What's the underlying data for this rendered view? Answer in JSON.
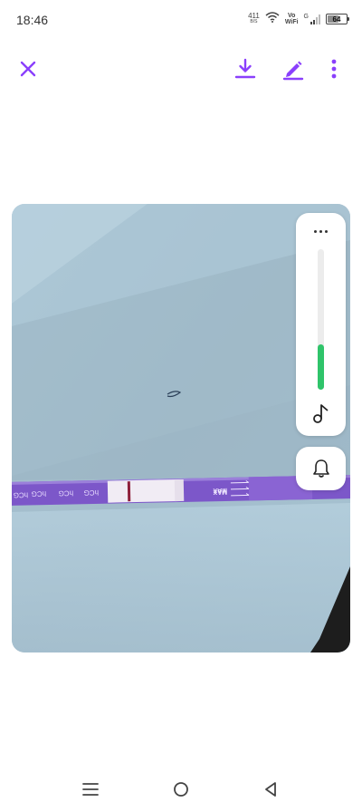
{
  "status_bar": {
    "time": "18:46",
    "net_speed_value": "411",
    "net_speed_unit": "B/S",
    "volte_top": "Vo",
    "volte_bottom": "WiFi",
    "network_type": "G",
    "battery_level": "64",
    "battery_fraction": 0.64
  },
  "toolbar": {
    "accent_color": "#8a3ffc",
    "icons": [
      "close-icon",
      "download-icon",
      "edit-icon",
      "more-vert-icon"
    ]
  },
  "photo": {
    "strip_labels": [
      "hCG",
      "hCG",
      "hCG",
      "hCG"
    ],
    "max_label": "MAX"
  },
  "volume_panel": {
    "level_fraction": 0.32,
    "fill_color": "#2fc46a",
    "icons": [
      "more-horiz-icon",
      "music-note-icon",
      "bell-icon"
    ]
  },
  "nav_bar": {
    "icons": [
      "menu-icon",
      "home-circle-icon",
      "back-triangle-icon"
    ]
  }
}
